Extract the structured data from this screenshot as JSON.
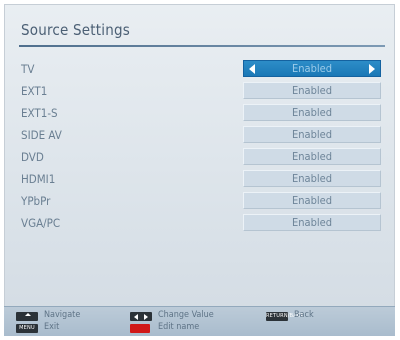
{
  "menu": {
    "title": "Source Settings",
    "sources": [
      {
        "label": "TV",
        "value": "Enabled",
        "selected": true
      },
      {
        "label": "EXT1",
        "value": "Enabled",
        "selected": false
      },
      {
        "label": "EXT1-S",
        "value": "Enabled",
        "selected": false
      },
      {
        "label": "SIDE AV",
        "value": "Enabled",
        "selected": false
      },
      {
        "label": "DVD",
        "value": "Enabled",
        "selected": false
      },
      {
        "label": "HDMI1",
        "value": "Enabled",
        "selected": false
      },
      {
        "label": "YPbPr",
        "value": "Enabled",
        "selected": false
      },
      {
        "label": "VGA/PC",
        "value": "Enabled",
        "selected": false
      }
    ]
  },
  "footer": {
    "navigate": "Navigate",
    "change_value": "Change Value",
    "back": "Back",
    "exit": "Exit",
    "edit_name": "Edit name",
    "return_key": "RETURN/BACK",
    "menu_key": "MENU"
  },
  "colors": {
    "selected": "#1e7fbf",
    "panel": "#dde4ea",
    "value_bg": "#cfdbe6",
    "edit_key": "#d01818"
  },
  "icons": {
    "navigate": "up-down-key-icon",
    "change_value": "left-right-key-icon",
    "back": "return-key-icon",
    "exit": "menu-key-icon",
    "edit_name": "red-key-icon"
  }
}
